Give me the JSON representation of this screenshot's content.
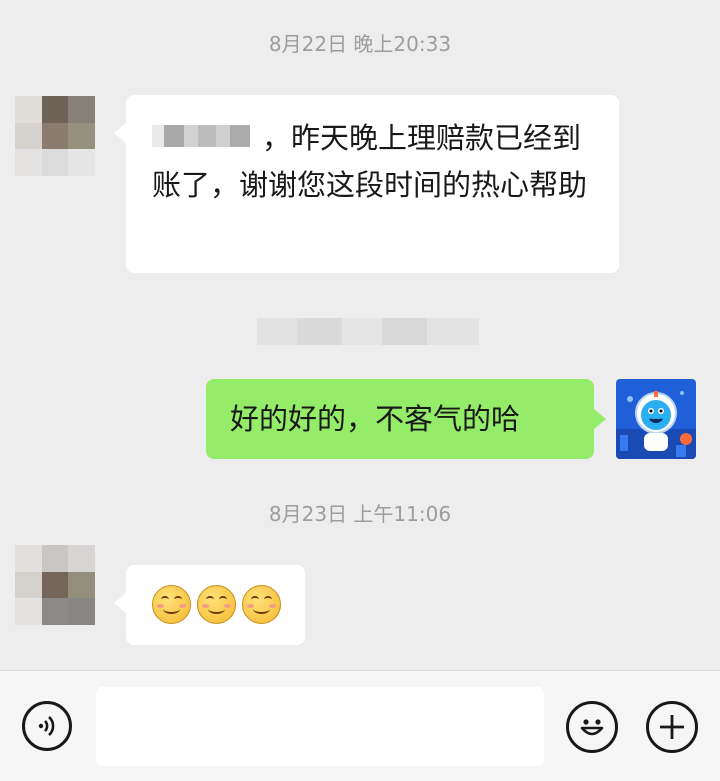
{
  "chat": {
    "timestamp_1": "8月22日 晚上20:33",
    "msg_1_text": "，昨天晚上理赔款已经到账了，谢谢您这段时间的热心帮助",
    "msg_2_text": "好的好的，不客气的哈",
    "timestamp_2": "8月23日 上午11:06",
    "msg_3_emojis": [
      "smiling-blush-emoji",
      "smiling-blush-emoji",
      "smiling-blush-emoji"
    ]
  },
  "input_bar": {
    "voice_icon": "voice-icon",
    "emoji_icon": "emoji-icon",
    "more_icon": "plus-icon",
    "message_value": ""
  },
  "colors": {
    "background": "#ededed",
    "incoming_bubble": "#ffffff",
    "outgoing_bubble": "#95ec69",
    "timestamp_text": "#9d9d9d"
  }
}
